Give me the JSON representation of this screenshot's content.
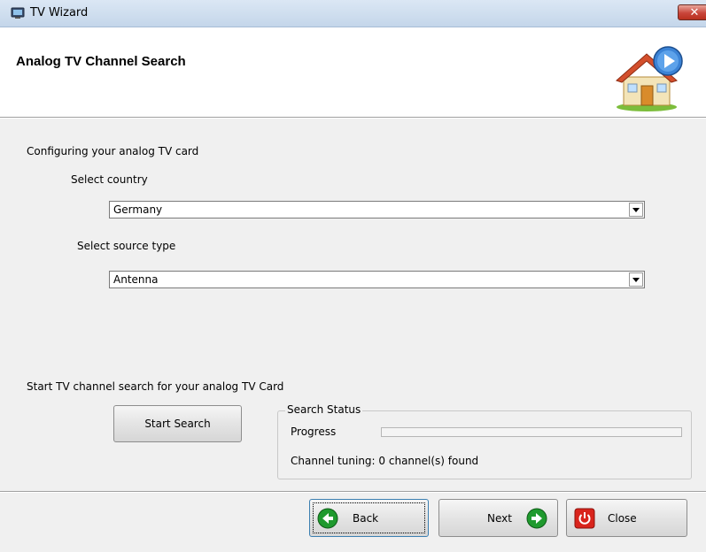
{
  "window": {
    "title": "TV Wizard",
    "close_glyph": "✕"
  },
  "header": {
    "title": "Analog TV Channel Search",
    "icon": "house-play-icon"
  },
  "config": {
    "section_label": "Configuring your analog TV card",
    "country_label": "Select  country",
    "country_value": "Germany",
    "source_label": "Select source type",
    "source_value": "Antenna"
  },
  "search": {
    "section_label": "Start TV channel search for your analog TV Card",
    "start_button": "Start Search",
    "status_legend": "Search Status",
    "progress_label": "Progress",
    "progress_fraction": 0,
    "result_text": "Channel tuning: 0 channel(s) found"
  },
  "footer": {
    "back_label": "Back",
    "next_label": "Next",
    "close_label": "Close"
  },
  "colors": {
    "back_next_icon": "#1f9a2e",
    "close_icon": "#d9241c",
    "progress_fill": "#36b34a"
  }
}
